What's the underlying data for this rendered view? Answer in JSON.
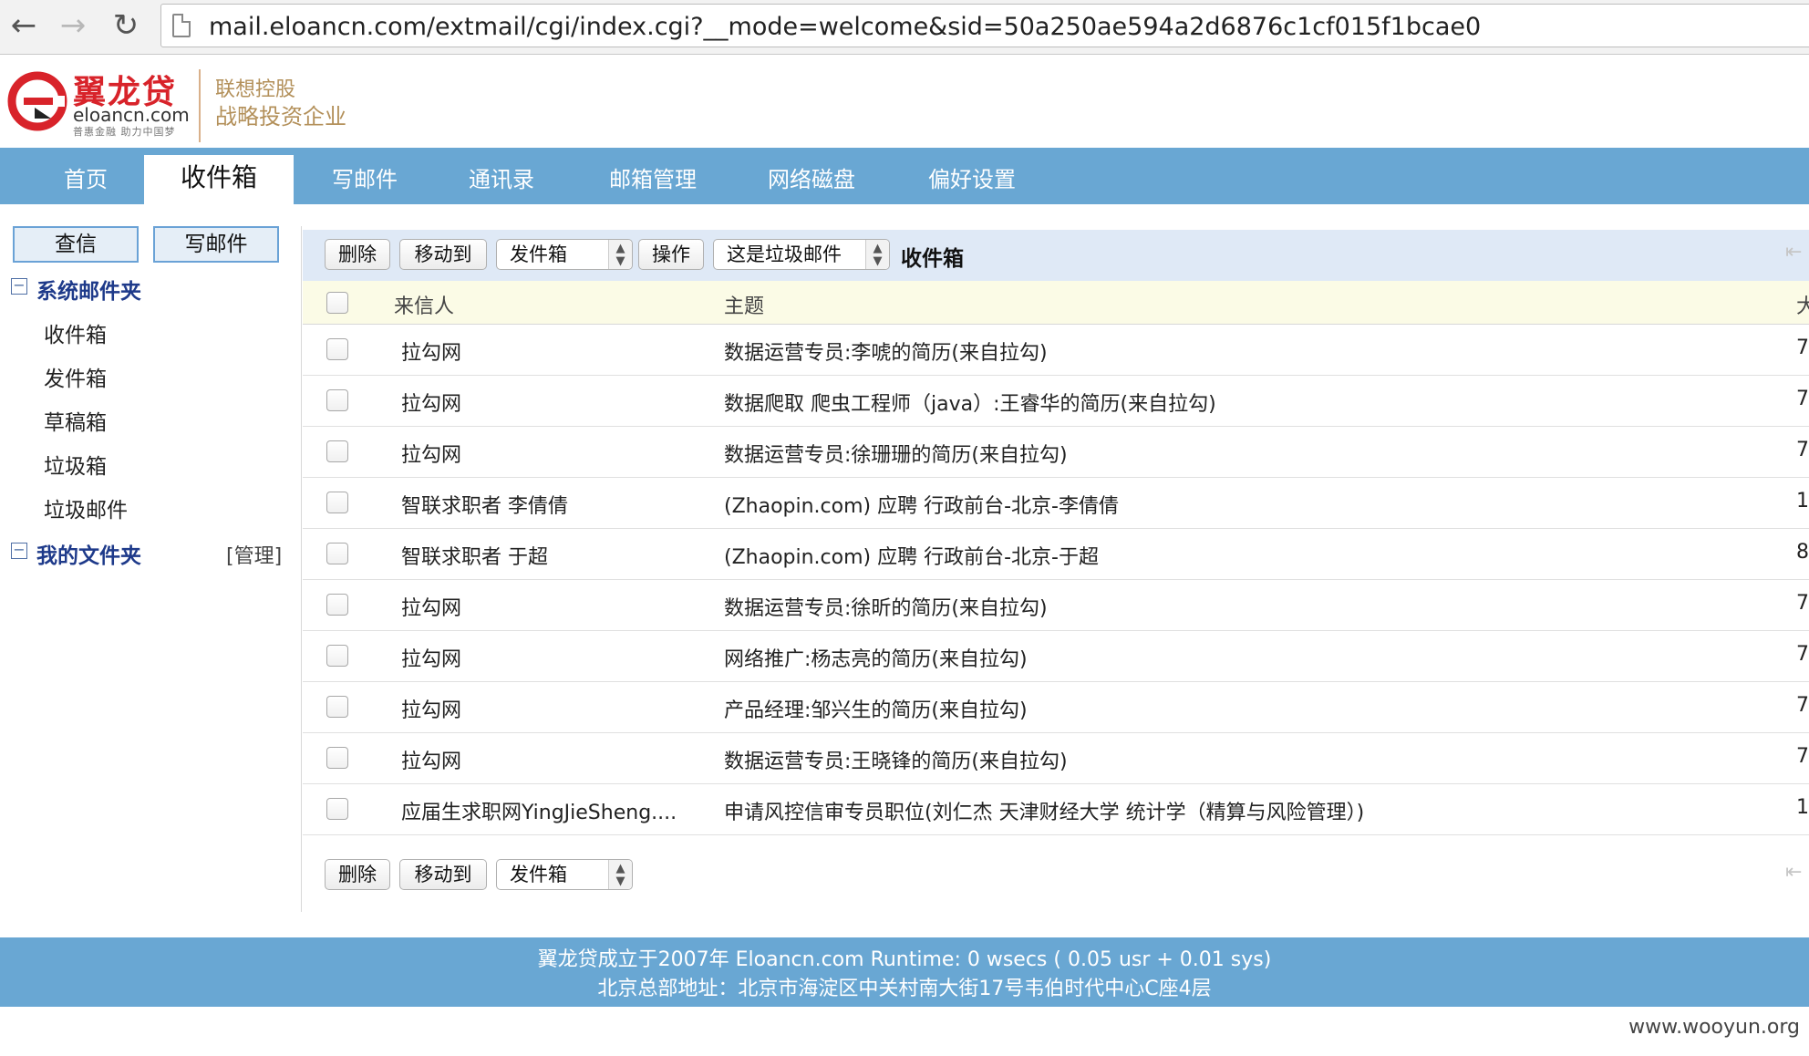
{
  "browser": {
    "url": "mail.eloancn.com/extmail/cgi/index.cgi?__mode=welcome&sid=50a250ae594a2d6876c1cf015f1bcae0"
  },
  "logo": {
    "name": "翼龙贷",
    "domain": "eloancn.com",
    "slogan": "普惠金融 助力中国梦",
    "tagline1": "联想控股",
    "tagline2": "战略投资企业"
  },
  "topnav": {
    "items": [
      "首页",
      "收件箱",
      "写邮件",
      "通讯录",
      "邮箱管理",
      "网络磁盘",
      "偏好设置"
    ],
    "active_index": 1
  },
  "sidebar": {
    "check_mail": "查信",
    "compose": "写邮件",
    "system_folders_title": "系统邮件夹",
    "system_folders": [
      "收件箱",
      "发件箱",
      "草稿箱",
      "垃圾箱",
      "垃圾邮件"
    ],
    "my_folders_title": "我的文件夹",
    "manage_label": "[管理]"
  },
  "toolbar": {
    "delete_label": "删除",
    "move_label": "移动到",
    "move_target": "发件箱",
    "action_label": "操作",
    "spam_option": "这是垃圾邮件",
    "current_folder": "收件箱"
  },
  "table": {
    "columns": {
      "from": "来信人",
      "subject": "主题",
      "size": "大"
    },
    "rows": [
      {
        "from": "拉勾网",
        "subject": "数据运营专员:李唬的简历(来自拉勾)",
        "size": "7"
      },
      {
        "from": "拉勾网",
        "subject": "数据爬取 爬虫工程师（java）:王睿华的简历(来自拉勾)",
        "size": "7"
      },
      {
        "from": "拉勾网",
        "subject": "数据运营专员:徐珊珊的简历(来自拉勾)",
        "size": "7"
      },
      {
        "from": "智联求职者 李倩倩",
        "subject": "(Zhaopin.com) 应聘 行政前台-北京-李倩倩",
        "size": "1"
      },
      {
        "from": "智联求职者 于超",
        "subject": "(Zhaopin.com) 应聘 行政前台-北京-于超",
        "size": "8"
      },
      {
        "from": "拉勾网",
        "subject": "数据运营专员:徐昕的简历(来自拉勾)",
        "size": "7"
      },
      {
        "from": "拉勾网",
        "subject": "网络推广:杨志亮的简历(来自拉勾)",
        "size": "7"
      },
      {
        "from": "拉勾网",
        "subject": "产品经理:邹兴生的简历(来自拉勾)",
        "size": "7"
      },
      {
        "from": "拉勾网",
        "subject": "数据运营专员:王晓锋的简历(来自拉勾)",
        "size": "7"
      },
      {
        "from": "应届生求职网YingJieSheng....",
        "subject": "申请风控信审专员职位(刘仁杰 天津财经大学 统计学（精算与风险管理）)",
        "size": "1"
      }
    ]
  },
  "footer": {
    "line1": "翼龙贷成立于2007年 Eloancn.com Runtime: 0 wsecs ( 0.05 usr + 0.01 sys)",
    "line2": "北京总部地址：北京市海淀区中关村南大街17号韦伯时代中心C座4层"
  },
  "watermark": "www.wooyun.org",
  "colors": {
    "nav_blue": "#69a7d3",
    "brand_red": "#d8232a",
    "toolbar_bg": "#dfe9f6",
    "header_row_bg": "#fbfbe6"
  }
}
